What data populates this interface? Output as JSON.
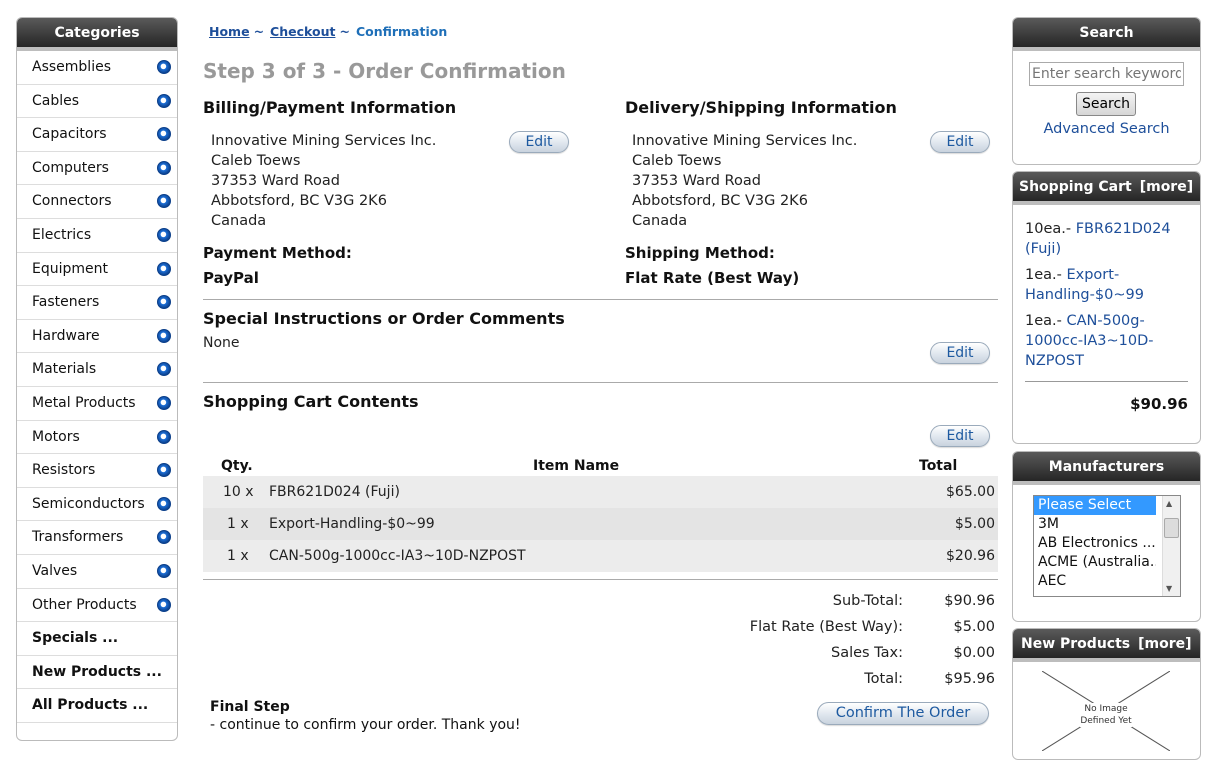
{
  "categories": {
    "title": "Categories",
    "items": [
      {
        "label": "Assemblies",
        "bold": false
      },
      {
        "label": "Cables",
        "bold": false
      },
      {
        "label": "Capacitors",
        "bold": false
      },
      {
        "label": "Computers",
        "bold": false
      },
      {
        "label": "Connectors",
        "bold": false
      },
      {
        "label": "Electrics",
        "bold": false
      },
      {
        "label": "Equipment",
        "bold": false
      },
      {
        "label": "Fasteners",
        "bold": false
      },
      {
        "label": "Hardware",
        "bold": false
      },
      {
        "label": "Materials",
        "bold": false
      },
      {
        "label": "Metal Products",
        "bold": false
      },
      {
        "label": "Motors",
        "bold": false
      },
      {
        "label": "Resistors",
        "bold": false
      },
      {
        "label": "Semiconductors",
        "bold": false
      },
      {
        "label": "Transformers",
        "bold": false
      },
      {
        "label": "Valves",
        "bold": false
      },
      {
        "label": "Other Products",
        "bold": false
      },
      {
        "label": "Specials ...",
        "bold": true
      },
      {
        "label": "New Products ...",
        "bold": true
      },
      {
        "label": "All Products ...",
        "bold": true
      }
    ]
  },
  "breadcrumb": {
    "home": "Home",
    "sep": "~",
    "checkout": "Checkout",
    "current": "Confirmation"
  },
  "main": {
    "step_title": "Step 3 of 3 - Order Confirmation",
    "billing": {
      "title": "Billing/Payment Information",
      "lines": [
        "Innovative Mining Services Inc.",
        "Caleb Toews",
        "37353 Ward Road",
        "Abbotsford, BC V3G 2K6",
        "Canada"
      ],
      "method_label": "Payment Method:",
      "method_value": "PayPal"
    },
    "delivery": {
      "title": "Delivery/Shipping Information",
      "lines": [
        "Innovative Mining Services Inc.",
        "Caleb Toews",
        "37353 Ward Road",
        "Abbotsford, BC V3G 2K6",
        "Canada"
      ],
      "method_label": "Shipping Method:",
      "method_value": "Flat Rate (Best Way)"
    },
    "edit_label": "Edit",
    "instructions": {
      "title": "Special Instructions or Order Comments",
      "value": "None"
    },
    "cart": {
      "title": "Shopping Cart Contents",
      "col_qty": "Qty.",
      "col_name": "Item Name",
      "col_total": "Total",
      "rows": [
        {
          "qty": "10 x",
          "name": "FBR621D024 (Fuji)",
          "total": "$65.00"
        },
        {
          "qty": "1 x",
          "name": "Export-Handling-$0~99",
          "total": "$5.00"
        },
        {
          "qty": "1 x",
          "name": "CAN-500g-1000cc-IA3~10D-NZPOST",
          "total": "$20.96"
        }
      ]
    },
    "totals": [
      {
        "label": "Sub-Total:",
        "value": "$90.96"
      },
      {
        "label": "Flat Rate (Best Way):",
        "value": "$5.00"
      },
      {
        "label": "Sales Tax:",
        "value": "$0.00"
      },
      {
        "label": "Total:",
        "value": "$95.96"
      }
    ],
    "final_step": {
      "title": "Final Step",
      "text": "- continue to confirm your order. Thank you!"
    },
    "confirm_label": "Confirm The Order"
  },
  "search": {
    "title": "Search",
    "placeholder": "Enter search keywords",
    "button": "Search",
    "advanced": "Advanced Search"
  },
  "side_cart": {
    "title": "Shopping Cart",
    "more": "[more]",
    "items": [
      {
        "qty": "10ea.-",
        "name": "FBR621D024 (Fuji)"
      },
      {
        "qty": "1ea.-",
        "name": "Export-Handling-$0~99"
      },
      {
        "qty": "1ea.-",
        "name": "CAN-500g-1000cc-IA3~10D-NZPOST"
      }
    ],
    "total": "$90.96"
  },
  "manufacturers": {
    "title": "Manufacturers",
    "options": [
      "Please Select",
      "3M",
      "AB Electronics ...",
      "ACME (Australia...",
      "AEC"
    ]
  },
  "new_products": {
    "title": "New Products",
    "more": "[more]",
    "placeholder_text": "No Image Defined Yet"
  }
}
